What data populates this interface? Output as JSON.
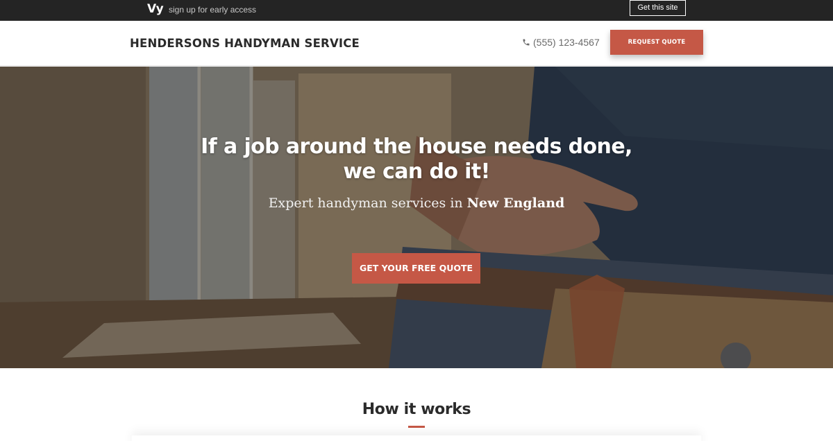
{
  "promo": {
    "logo": "Vy",
    "text": "sign up for early access",
    "button": "Get this site"
  },
  "header": {
    "brand": "HENDERSONS HANDYMAN SERVICE",
    "phone": "(555) 123-4567",
    "quote_button": "REQUEST QUOTE"
  },
  "hero": {
    "title_line1": "If a job around the house needs done,",
    "title_line2": "we can do it!",
    "subtitle_prefix": "Expert handyman services in ",
    "subtitle_region": "New England",
    "cta": "GET YOUR FREE QUOTE"
  },
  "how": {
    "title": "How it works"
  },
  "colors": {
    "accent": "#c55846",
    "promo_bar": "#242424",
    "text_dark": "#2b2b2b"
  },
  "icons": {
    "phone": "phone-icon"
  }
}
